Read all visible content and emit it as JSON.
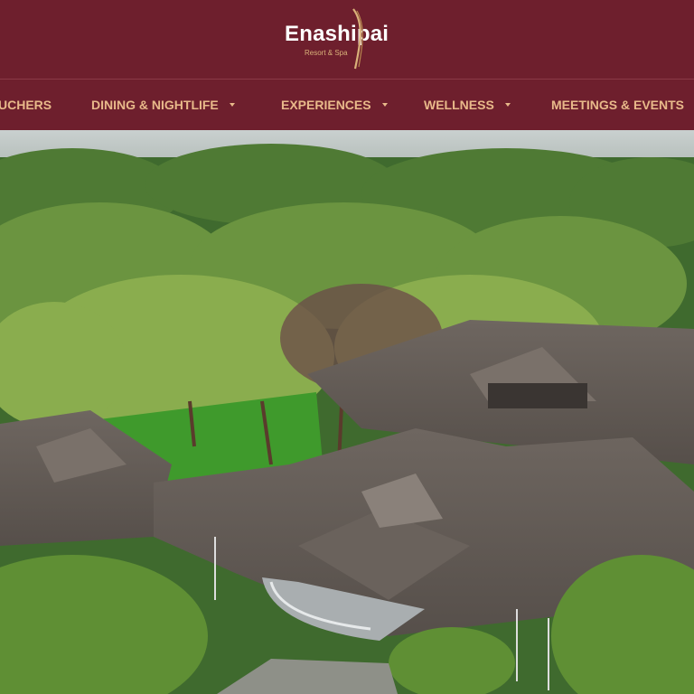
{
  "brand": {
    "name": "Enashipai",
    "tagline": "Resort & Spa",
    "colors": {
      "primary": "#6e1f2d",
      "nav_text": "#e8b98a",
      "logo_accent": "#d9b27a"
    }
  },
  "nav": {
    "items": [
      {
        "label": "UCHERS",
        "has_dropdown": false
      },
      {
        "label": "DINING & NIGHTLIFE",
        "has_dropdown": true
      },
      {
        "label": "EXPERIENCES",
        "has_dropdown": true
      },
      {
        "label": "WELLNESS",
        "has_dropdown": true
      },
      {
        "label": "MEETINGS & EVENTS",
        "has_dropdown": true
      }
    ]
  },
  "hero": {
    "image": "aerial-resort-photo"
  }
}
